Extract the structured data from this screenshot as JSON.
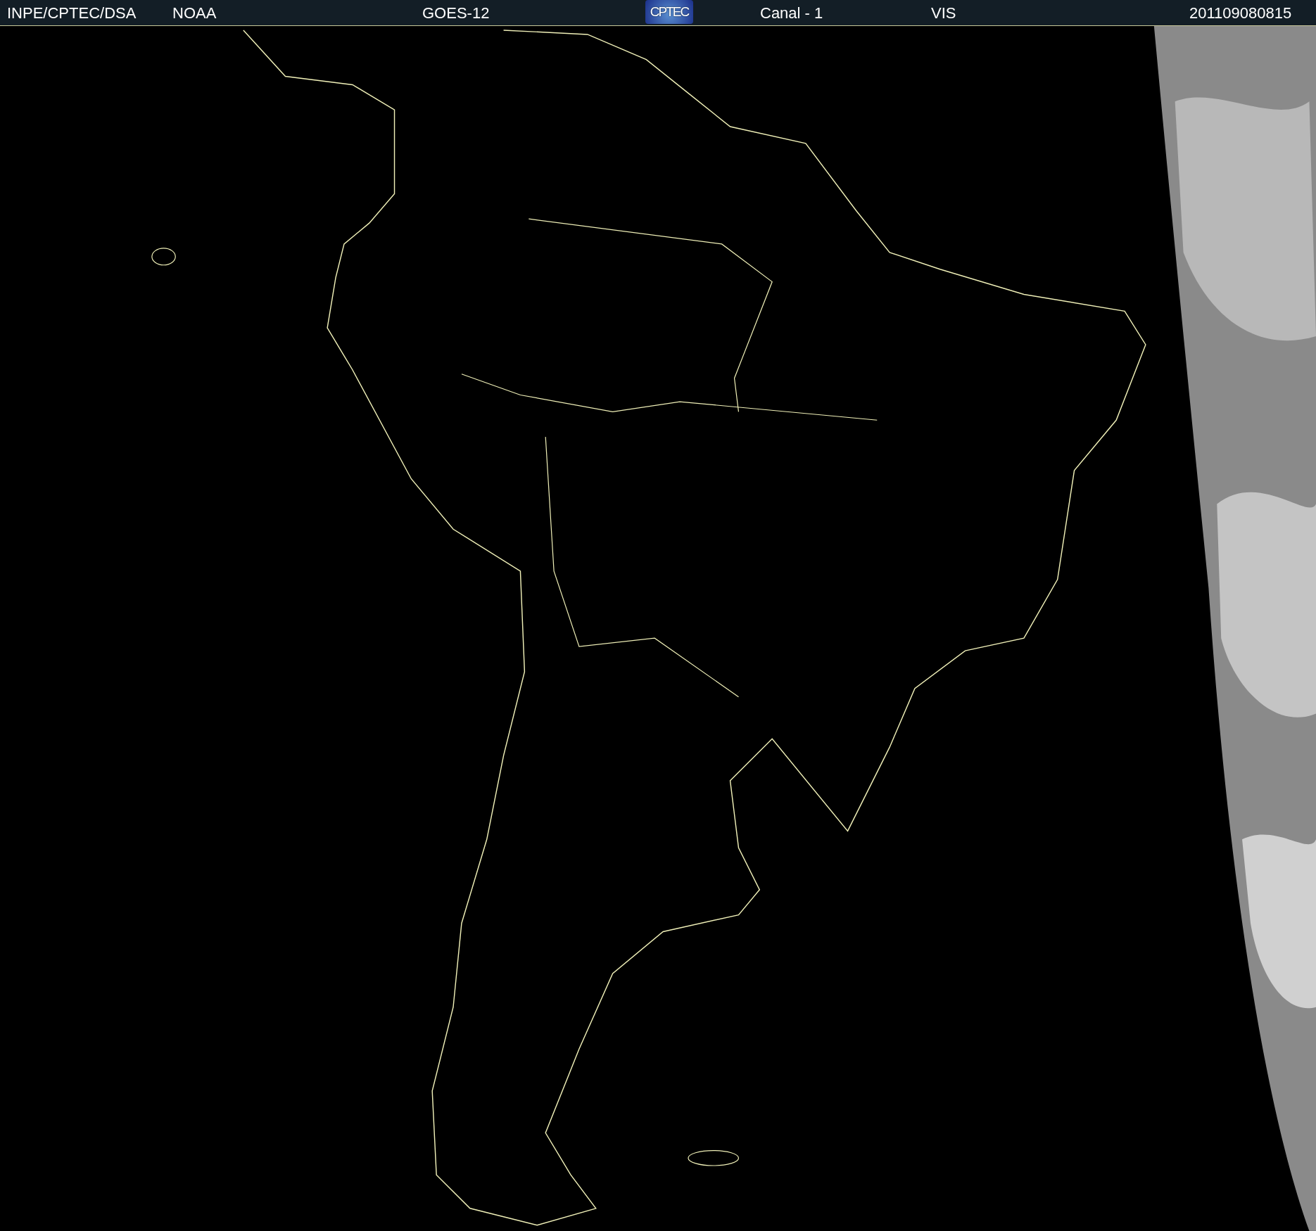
{
  "header": {
    "items": [
      {
        "kind": "text",
        "label": "INPE/CPTEC/DSA"
      },
      {
        "kind": "text",
        "label": "NOAA"
      },
      {
        "kind": "text",
        "label": "GOES-12"
      },
      {
        "kind": "logo",
        "label": "CPTEC"
      },
      {
        "kind": "text",
        "label": "Canal - 1"
      },
      {
        "kind": "text",
        "label": "VIS"
      },
      {
        "kind": "text",
        "label": "201109080815"
      }
    ]
  }
}
